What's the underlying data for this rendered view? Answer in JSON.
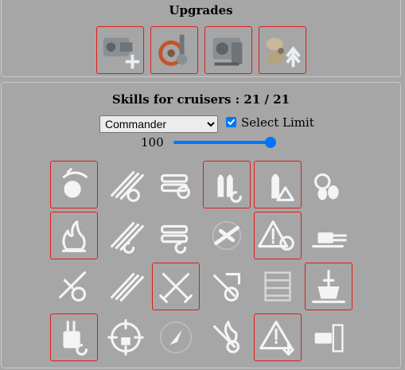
{
  "upgrades": {
    "title": "Upgrades",
    "items": [
      {
        "icon": "main-armaments-modification-icon",
        "selected": true
      },
      {
        "icon": "aiming-systems-modification-icon",
        "selected": true
      },
      {
        "icon": "damage-control-system-icon",
        "selected": true
      },
      {
        "icon": "propulsion-modification-icon",
        "selected": true
      }
    ]
  },
  "skills": {
    "title": "Skills for cruisers : 21 / 21",
    "commander_select": {
      "value": "Commander",
      "options": [
        "Commander"
      ]
    },
    "select_limit": {
      "label": "Select Limit",
      "checked": true
    },
    "slider": {
      "value": "100",
      "fraction": 1.0
    },
    "rows": [
      [
        {
          "icon": "grease-the-gears-icon",
          "selected": true
        },
        {
          "icon": "gun-feeder-icon",
          "selected": false
        },
        {
          "icon": "demolition-expert-icon",
          "selected": false
        },
        {
          "icon": "main-battery-reload-icon",
          "selected": true
        },
        {
          "icon": "shell-warning-icon",
          "selected": true
        },
        {
          "icon": "dead-eye-icon",
          "selected": false
        }
      ],
      [
        {
          "icon": "fire-icon",
          "selected": true
        },
        {
          "icon": "swift-fish-icon",
          "selected": false
        },
        {
          "icon": "torpedo-reload-icon",
          "selected": false
        },
        {
          "icon": "aircraft-icon",
          "selected": false
        },
        {
          "icon": "radio-location-icon",
          "selected": true
        },
        {
          "icon": "secondary-gun-icon",
          "selected": false
        }
      ],
      [
        {
          "icon": "incoming-fire-alert-icon",
          "selected": false
        },
        {
          "icon": "torpedo-armament-icon",
          "selected": false
        },
        {
          "icon": "crossed-swords-icon",
          "selected": true
        },
        {
          "icon": "damage-control-party-icon",
          "selected": false
        },
        {
          "icon": "torpedo-rack-icon",
          "selected": false
        },
        {
          "icon": "superintendent-icon",
          "selected": true
        }
      ],
      [
        {
          "icon": "turret-reload-icon",
          "selected": true
        },
        {
          "icon": "concealment-crosshair-icon",
          "selected": false
        },
        {
          "icon": "compass-navigation-icon",
          "selected": false
        },
        {
          "icon": "fire-prevention-icon",
          "selected": false
        },
        {
          "icon": "priority-target-icon",
          "selected": true
        },
        {
          "icon": "adrenaline-rush-icon",
          "selected": false
        }
      ]
    ]
  }
}
